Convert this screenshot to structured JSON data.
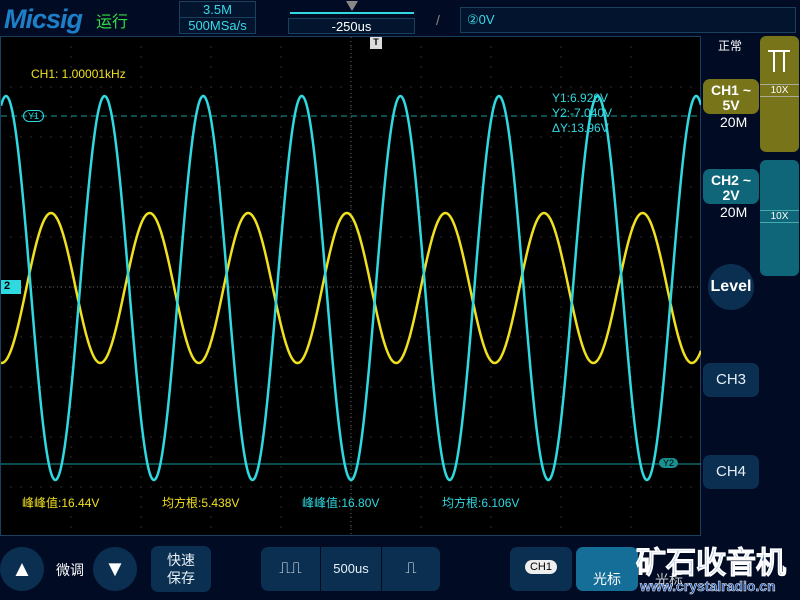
{
  "header": {
    "brand": "Micsig",
    "run_state": "运行",
    "memory_depth": "3.5M",
    "sample_rate": "500MSa/s",
    "trigger_position": "-250us",
    "trigger_edge_icon": "rising-edge",
    "trigger_info": "②0V"
  },
  "plot": {
    "ch1_frequency": "CH1: 1.00001kHz",
    "trigger_marker": "T",
    "ch2_marker": "2",
    "cursor_y1_label": "Y1",
    "cursor_y2_label": "Y2",
    "cursor_readout": {
      "y1": "Y1:6.920V",
      "y2": "Y2:-7.040V",
      "dy": "ΔY:13.96V"
    },
    "measurements": [
      {
        "text": "峰峰值:16.44V",
        "color": "#f0e020"
      },
      {
        "text": "均方根:5.438V",
        "color": "#f0e020"
      },
      {
        "text": "峰峰值:16.80V",
        "color": "#30d8e0"
      },
      {
        "text": "均方根:6.106V",
        "color": "#30d8e0"
      }
    ],
    "waveforms": {
      "ch1": {
        "color": "#f0e020",
        "frequency_hz": 1000.01,
        "vpp": 16.44
      },
      "ch2": {
        "color": "#30d8e0",
        "frequency_hz": 1000.01,
        "vpp": 16.8
      }
    }
  },
  "side": {
    "mode": "正常",
    "ch1": {
      "label": "CH1 ~",
      "scale": "5V",
      "bw": "20M",
      "probe": "10X",
      "color": "#77741a"
    },
    "ch2": {
      "label": "CH2 ~",
      "scale": "2V",
      "bw": "20M",
      "probe": "10X",
      "color": "#0e6678"
    },
    "level": "Level",
    "ch3": "CH3",
    "ch4": "CH4"
  },
  "bottom": {
    "fine_tune": "微调",
    "quick_save_1": "快速",
    "quick_save_2": "保存",
    "timebase": "500us",
    "ch_select": "CH1",
    "cursor1": "光标",
    "cursor2": "光标",
    "watermark": "矿石收音机",
    "watermark_url": "www.crystalradio.cn"
  }
}
